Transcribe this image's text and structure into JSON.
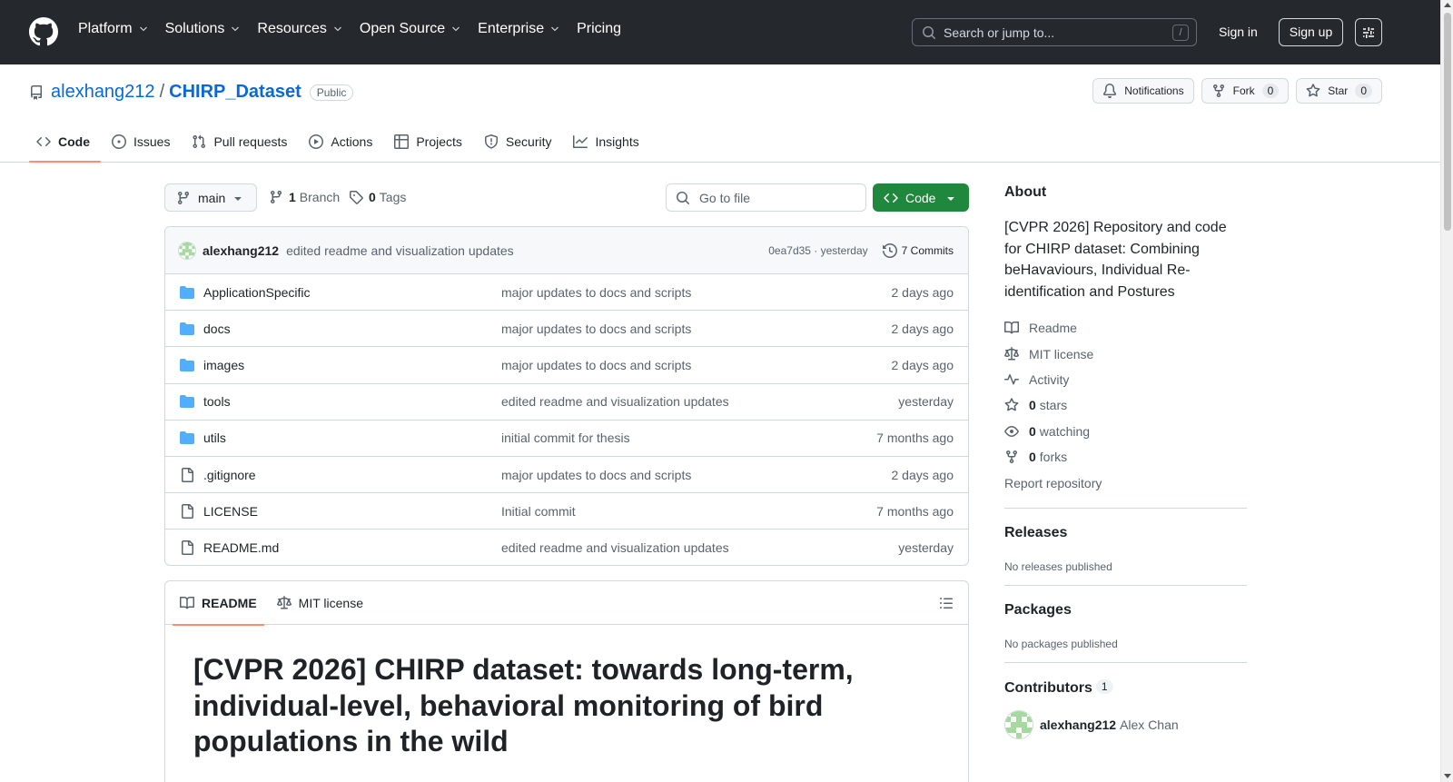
{
  "header": {
    "nav": [
      {
        "label": "Platform",
        "dropdown": true
      },
      {
        "label": "Solutions",
        "dropdown": true
      },
      {
        "label": "Resources",
        "dropdown": true
      },
      {
        "label": "Open Source",
        "dropdown": true
      },
      {
        "label": "Enterprise",
        "dropdown": true
      },
      {
        "label": "Pricing",
        "dropdown": false
      }
    ],
    "search_placeholder": "Search or jump to...",
    "search_shortcut": "/",
    "sign_in": "Sign in",
    "sign_up": "Sign up"
  },
  "repo": {
    "owner": "alexhang212",
    "separator": "/",
    "name": "CHIRP_Dataset",
    "visibility": "Public",
    "notifications_label": "Notifications",
    "fork_label": "Fork",
    "fork_count": "0",
    "star_label": "Star",
    "star_count": "0",
    "tabs": [
      "Code",
      "Issues",
      "Pull requests",
      "Actions",
      "Projects",
      "Security",
      "Insights"
    ]
  },
  "browser": {
    "branch": "main",
    "branch_count": "1",
    "branch_label": "Branch",
    "tag_count": "0",
    "tag_label": "Tags",
    "goto_placeholder": "Go to file",
    "code_button": "Code"
  },
  "commit": {
    "author": "alexhang212",
    "message": "edited readme and visualization updates",
    "hash_time": "0ea7d35 · yesterday",
    "commits_label": "7 Commits"
  },
  "files": [
    {
      "type": "dir",
      "name": "ApplicationSpecific",
      "message": "major updates to docs and scripts",
      "age": "2 days ago"
    },
    {
      "type": "dir",
      "name": "docs",
      "message": "major updates to docs and scripts",
      "age": "2 days ago"
    },
    {
      "type": "dir",
      "name": "images",
      "message": "major updates to docs and scripts",
      "age": "2 days ago"
    },
    {
      "type": "dir",
      "name": "tools",
      "message": "edited readme and visualization updates",
      "age": "yesterday"
    },
    {
      "type": "dir",
      "name": "utils",
      "message": "initial commit for thesis",
      "age": "7 months ago"
    },
    {
      "type": "file",
      "name": ".gitignore",
      "message": "major updates to docs and scripts",
      "age": "2 days ago"
    },
    {
      "type": "file",
      "name": "LICENSE",
      "message": "Initial commit",
      "age": "7 months ago"
    },
    {
      "type": "file",
      "name": "README.md",
      "message": "edited readme and visualization updates",
      "age": "yesterday"
    }
  ],
  "readme": {
    "tab_readme": "README",
    "tab_license": "MIT license",
    "heading": "[CVPR 2026] CHIRP dataset: towards long-term, individual-level, behavioral monitoring of bird populations in the wild"
  },
  "sidebar": {
    "about_title": "About",
    "description": "[CVPR 2026] Repository and code for CHIRP dataset: Combining beHavaviours, Individual Re-identification and Postures",
    "links": {
      "readme": "Readme",
      "license": "MIT license",
      "activity": "Activity",
      "stars_count": "0",
      "stars_label": "stars",
      "watching_count": "0",
      "watching_label": "watching",
      "forks_count": "0",
      "forks_label": "forks",
      "report": "Report repository"
    },
    "releases_title": "Releases",
    "releases_empty": "No releases published",
    "packages_title": "Packages",
    "packages_empty": "No packages published",
    "contributors_title": "Contributors",
    "contributors_count": "1",
    "contributor_login": "alexhang212",
    "contributor_name": "Alex Chan"
  },
  "colors": {
    "header_bg": "#25292e",
    "link": "#0969da",
    "primary_button": "#1f883d",
    "folder_icon": "#54aeff",
    "tab_underline": "#fd8c73"
  }
}
